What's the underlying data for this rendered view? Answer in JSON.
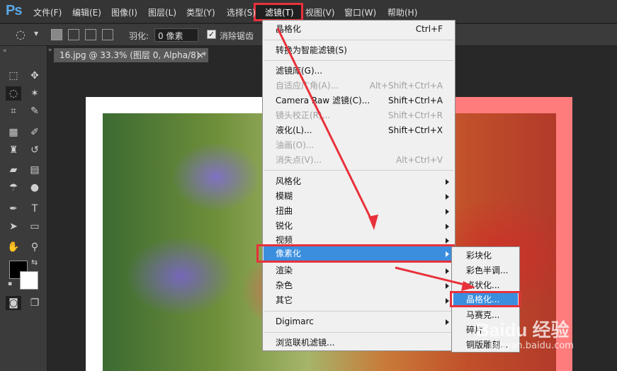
{
  "app": {
    "logo": "Ps"
  },
  "menubar": {
    "items": [
      "文件(F)",
      "编辑(E)",
      "图像(I)",
      "图层(L)",
      "类型(Y)",
      "选择(S)",
      "滤镜(T)",
      "视图(V)",
      "窗口(W)",
      "帮助(H)"
    ]
  },
  "options": {
    "feather_label": "羽化:",
    "feather_value": "0 像素",
    "antialias_label": "消除锯齿"
  },
  "document": {
    "tab_title": "16.jpg @ 33.3% (图层 0, Alpha/8) *",
    "tab_close": "×"
  },
  "filter_menu": {
    "items": [
      {
        "label": "晶格化",
        "shortcut": "Ctrl+F",
        "disabled": false
      },
      {
        "label": "转换为智能滤镜(S)",
        "shortcut": "",
        "disabled": false
      },
      {
        "label": "滤镜库(G)...",
        "shortcut": "",
        "disabled": false
      },
      {
        "label": "自适应广角(A)...",
        "shortcut": "Alt+Shift+Ctrl+A",
        "disabled": true
      },
      {
        "label": "Camera Raw 滤镜(C)...",
        "shortcut": "Shift+Ctrl+A",
        "disabled": false
      },
      {
        "label": "镜头校正(R)...",
        "shortcut": "Shift+Ctrl+R",
        "disabled": true
      },
      {
        "label": "液化(L)...",
        "shortcut": "Shift+Ctrl+X",
        "disabled": false
      },
      {
        "label": "油画(O)...",
        "shortcut": "",
        "disabled": true
      },
      {
        "label": "消失点(V)...",
        "shortcut": "Alt+Ctrl+V",
        "disabled": true
      },
      {
        "label": "风格化",
        "shortcut": "",
        "disabled": false
      },
      {
        "label": "模糊",
        "shortcut": "",
        "disabled": false
      },
      {
        "label": "扭曲",
        "shortcut": "",
        "disabled": false
      },
      {
        "label": "锐化",
        "shortcut": "",
        "disabled": false
      },
      {
        "label": "视频",
        "shortcut": "",
        "disabled": false
      },
      {
        "label": "像素化",
        "shortcut": "",
        "disabled": false
      },
      {
        "label": "渲染",
        "shortcut": "",
        "disabled": false
      },
      {
        "label": "杂色",
        "shortcut": "",
        "disabled": false
      },
      {
        "label": "其它",
        "shortcut": "",
        "disabled": false
      },
      {
        "label": "Digimarc",
        "shortcut": "",
        "disabled": false
      },
      {
        "label": "浏览联机滤镜...",
        "shortcut": "",
        "disabled": false
      }
    ]
  },
  "pixelate_submenu": {
    "items": [
      "彩块化",
      "彩色半调...",
      "点状化...",
      "晶格化...",
      "马赛克...",
      "碎片",
      "铜版雕刻..."
    ]
  },
  "watermark": {
    "text": "Baidu 经验",
    "sub": "jingyan.baidu.com"
  },
  "colors": {
    "highlight": "#3b8ede",
    "annotation_red": "#e8313a",
    "ps_blue": "#5aa8e6"
  }
}
